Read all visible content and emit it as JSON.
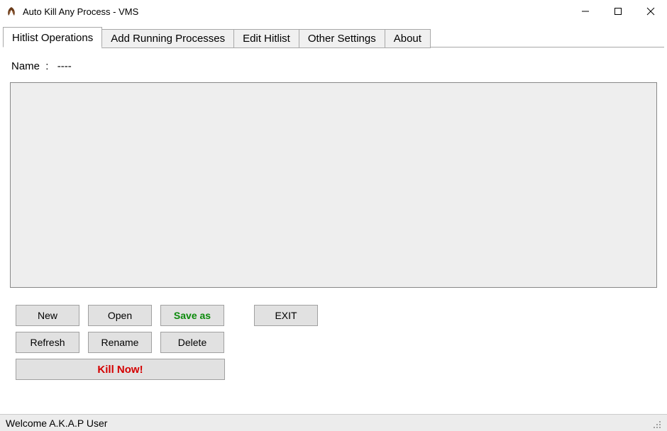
{
  "window": {
    "title": "Auto Kill Any Process - VMS"
  },
  "tabs": [
    {
      "label": "Hitlist Operations",
      "active": true
    },
    {
      "label": "Add Running Processes",
      "active": false
    },
    {
      "label": "Edit Hitlist",
      "active": false
    },
    {
      "label": "Other Settings",
      "active": false
    },
    {
      "label": "About",
      "active": false
    }
  ],
  "hitlist": {
    "name_label": "Name",
    "name_separator": ":",
    "name_value": "----"
  },
  "buttons": {
    "new": "New",
    "open": "Open",
    "saveas": "Save as",
    "exit": "EXIT",
    "refresh": "Refresh",
    "rename": "Rename",
    "delete": "Delete",
    "killnow": "Kill Now!"
  },
  "statusbar": {
    "message": "Welcome A.K.A.P User"
  }
}
